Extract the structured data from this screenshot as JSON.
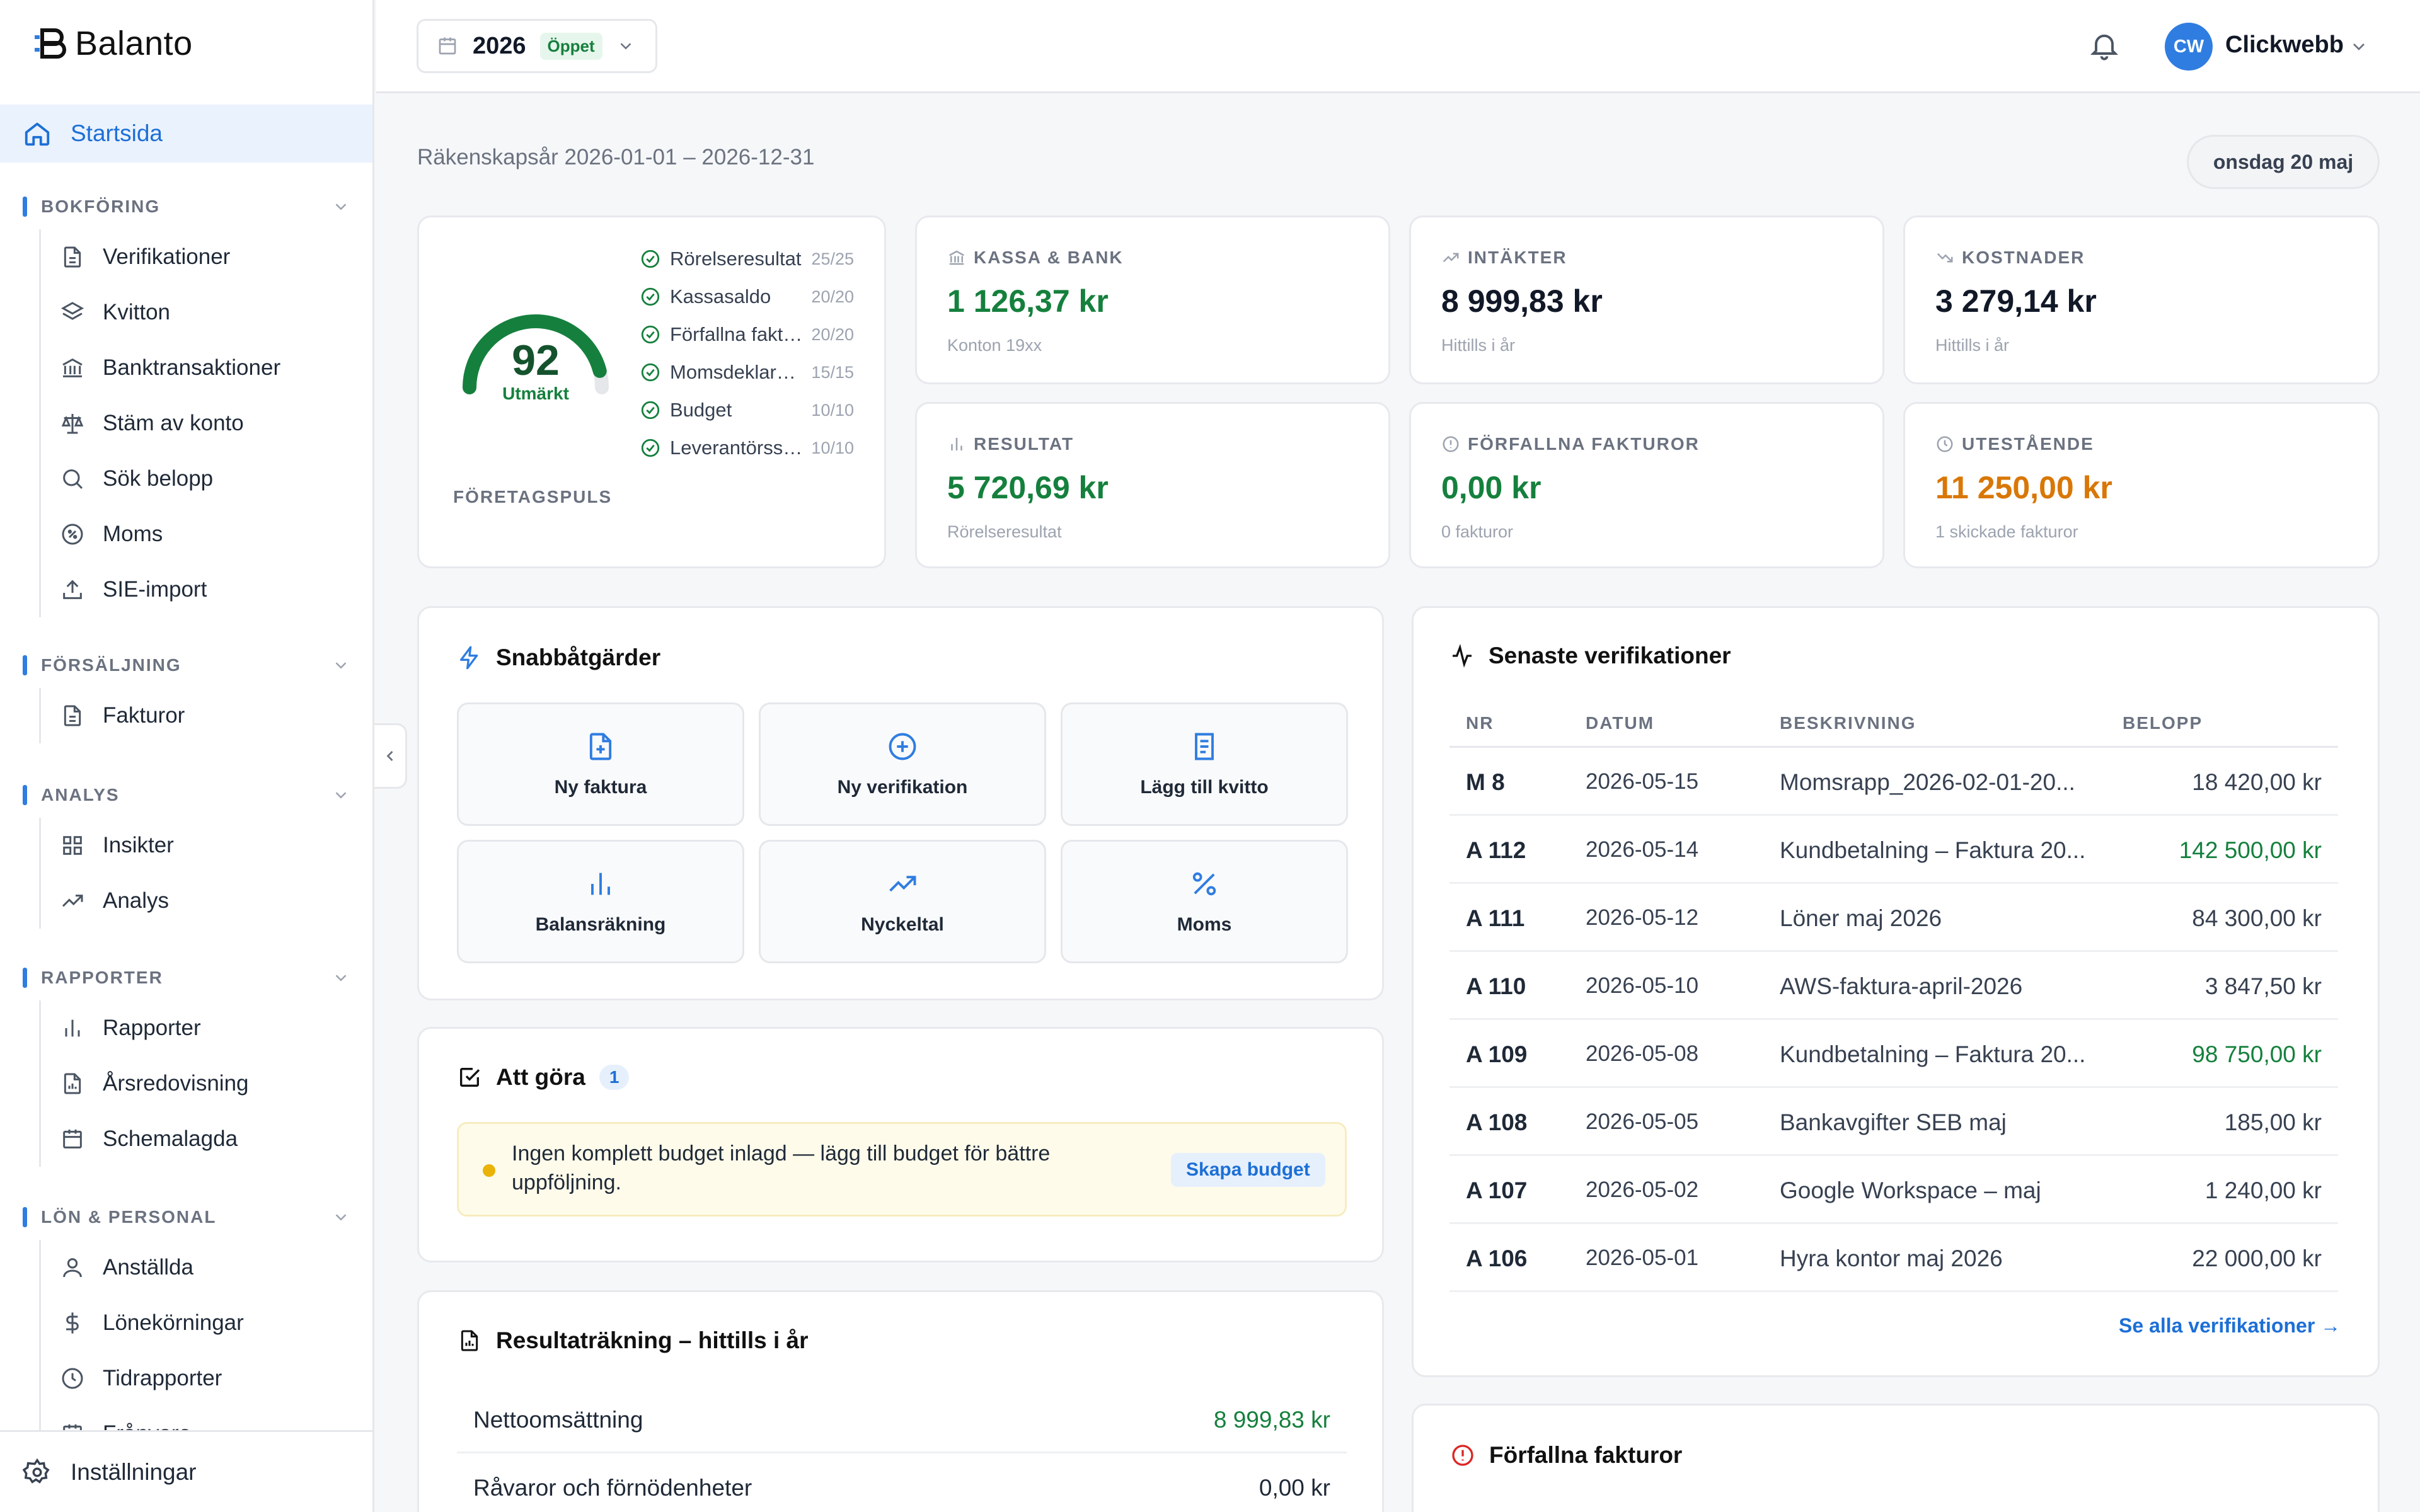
{
  "app": {
    "name": "Balanto"
  },
  "sidebar": {
    "home": "Startsida",
    "sections": [
      {
        "title": "BOKFÖRING",
        "items": [
          "Verifikationer",
          "Kvitton",
          "Banktransaktioner",
          "Stäm av konto",
          "Sök belopp",
          "Moms",
          "SIE-import"
        ]
      },
      {
        "title": "FÖRSÄLJNING",
        "items": [
          "Fakturor"
        ]
      },
      {
        "title": "ANALYS",
        "items": [
          "Insikter",
          "Analys"
        ]
      },
      {
        "title": "RAPPORTER",
        "items": [
          "Rapporter",
          "Årsredovisning",
          "Schemalagda"
        ]
      },
      {
        "title": "LÖN & PERSONAL",
        "items": [
          "Anställda",
          "Lönekörningar",
          "Tidrapporter",
          "Frånvaro"
        ]
      }
    ],
    "settings": "Inställningar"
  },
  "topbar": {
    "year": "2026",
    "year_status": "Öppet",
    "user_initials": "CW",
    "user_name": "Clickwebb"
  },
  "header": {
    "fiscal_year": "Räkenskapsår 2026-01-01 – 2026-12-31",
    "date": "onsdag 20 maj"
  },
  "pulse": {
    "score": "92",
    "rating": "Utmärkt",
    "label": "FÖRETAGSPULS",
    "score_fraction": 0.92,
    "items": [
      {
        "name": "Rörelseresultat",
        "score": "25/25"
      },
      {
        "name": "Kassasaldo",
        "score": "20/20"
      },
      {
        "name": "Förfallna fakturor",
        "score": "20/20"
      },
      {
        "name": "Momsdeklaration",
        "score": "15/15"
      },
      {
        "name": "Budget",
        "score": "10/10"
      },
      {
        "name": "Leverantörsskulder",
        "score": "10/10"
      }
    ]
  },
  "kpis": {
    "cash": {
      "label": "KASSA & BANK",
      "value": "1 126,37 kr",
      "sub": "Konton 19xx"
    },
    "income": {
      "label": "INTÄKTER",
      "value": "8 999,83 kr",
      "sub": "Hittills i år"
    },
    "costs": {
      "label": "KOSTNADER",
      "value": "3 279,14 kr",
      "sub": "Hittills i år"
    },
    "result": {
      "label": "RESULTAT",
      "value": "5 720,69 kr",
      "sub": "Rörelseresultat"
    },
    "overdue": {
      "label": "FÖRFALLNA FAKTUROR",
      "value": "0,00 kr",
      "sub": "0 fakturor"
    },
    "outstanding": {
      "label": "UTESTÅENDE",
      "value": "11 250,00 kr",
      "sub": "1 skickade fakturor"
    }
  },
  "quick": {
    "title": "Snabbåtgärder",
    "actions": [
      "Ny faktura",
      "Ny verifikation",
      "Lägg till kvitto",
      "Balansräkning",
      "Nyckeltal",
      "Moms"
    ]
  },
  "todo": {
    "title": "Att göra",
    "count": "1",
    "message": "Ingen komplett budget inlagd — lägg till budget för bättre uppföljning.",
    "action": "Skapa budget"
  },
  "income_statement": {
    "title": "Resultaträkning – hittills i år",
    "rows": [
      {
        "label": "Nettoomsättning",
        "value": "8 999,83 kr"
      },
      {
        "label": "Råvaror och förnödenheter",
        "value": "0,00 kr"
      }
    ]
  },
  "verifications": {
    "title": "Senaste verifikationer",
    "columns": [
      "NR",
      "DATUM",
      "BESKRIVNING",
      "BELOPP"
    ],
    "rows": [
      {
        "nr": "M 8",
        "date": "2026-05-15",
        "desc": "Momsrapp_2026-02-01-20...",
        "amount": "18 420,00 kr"
      },
      {
        "nr": "A 112",
        "date": "2026-05-14",
        "desc": "Kundbetalning – Faktura 20...",
        "amount": "142 500,00 kr"
      },
      {
        "nr": "A 111",
        "date": "2026-05-12",
        "desc": "Löner maj 2026",
        "amount": "84 300,00 kr"
      },
      {
        "nr": "A 110",
        "date": "2026-05-10",
        "desc": "AWS-faktura-april-2026",
        "amount": "3 847,50 kr"
      },
      {
        "nr": "A 109",
        "date": "2026-05-08",
        "desc": "Kundbetalning – Faktura 20...",
        "amount": "98 750,00 kr"
      },
      {
        "nr": "A 108",
        "date": "2026-05-05",
        "desc": "Bankavgifter SEB maj",
        "amount": "185,00 kr"
      },
      {
        "nr": "A 107",
        "date": "2026-05-02",
        "desc": "Google Workspace – maj",
        "amount": "1 240,00 kr"
      },
      {
        "nr": "A 106",
        "date": "2026-05-01",
        "desc": "Hyra kontor maj 2026",
        "amount": "22 000,00 kr"
      }
    ],
    "see_all": "Se alla verifikationer →"
  },
  "overdue_invoices": {
    "title": "Förfallna fakturor"
  },
  "colors": {
    "accent": "#2f7de1",
    "positive": "#15803d",
    "warning": "#d97706"
  }
}
